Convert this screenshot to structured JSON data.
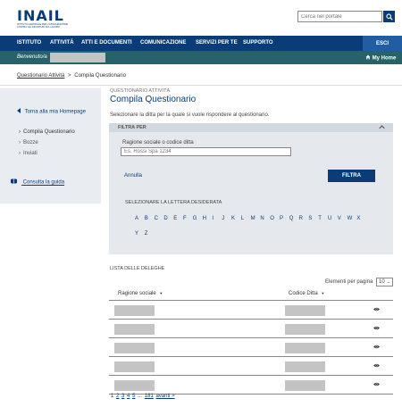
{
  "header": {
    "logo": "INAIL",
    "logo_subtitle": "ISTITUTO NAZIONALE PER L'ASSICURAZIONE CONTRO GLI INFORTUNI SUL LAVORO",
    "search_placeholder": "Cerca nel portale"
  },
  "nav": {
    "items": [
      "ISTITUTO",
      "ATTIVITÀ",
      "ATTI E DOCUMENTI",
      "COMUNICAZIONE",
      "SERVIZI PER TE",
      "SUPPORTO"
    ],
    "logout": "ESCI"
  },
  "welcome": {
    "label": "Benvenuto/a",
    "my_home": "My Home"
  },
  "breadcrumb": {
    "parent": "Questionario Attività",
    "separator": ">",
    "current": "Compila Questionario"
  },
  "sidebar": {
    "back": "Torna alla mia Homepage",
    "items": [
      "Compila Questionario",
      "Bozze",
      "Inviati"
    ],
    "guide": "Consulta la guida"
  },
  "main": {
    "section": "QUESTIONARIO ATTIVITÀ",
    "title": "Compila Questionario",
    "intro": "Selezionare la ditta per la quale si vuole rispondere al questionario."
  },
  "filter": {
    "header": "FILTRA PER",
    "field_label": "Ragione sociale o codice ditta",
    "field_placeholder": "Es. Rossi Spa 1234",
    "cancel": "Annulla",
    "submit": "FILTRA",
    "letters_label": "SELEZIONARE LA LETTERA DESIDERATA",
    "letters": [
      "A",
      "B",
      "C",
      "D",
      "E",
      "F",
      "G",
      "H",
      "I",
      "J",
      "K",
      "L",
      "M",
      "N",
      "O",
      "P",
      "Q",
      "R",
      "S",
      "T",
      "U",
      "V",
      "W",
      "X",
      "Y",
      "Z"
    ]
  },
  "list": {
    "title": "LISTA DELLE DELEGHE",
    "per_page_label": "Elementi per pagina",
    "per_page_value": "10",
    "columns": [
      "Ragione sociale",
      "Codice Ditta"
    ],
    "sort_glyph": "▼",
    "row_count": 5
  },
  "pagination": {
    "current": "1",
    "pages": [
      "2",
      "3",
      "4",
      "5"
    ],
    "ellipsis": "...",
    "last": "181",
    "next": "avanti >"
  },
  "colors": {
    "primary": "#0a3d78",
    "nav_accent": "#205da2",
    "welcome_bar": "#27626b",
    "sidebar_bg": "#e9edf2",
    "panel_bg": "#e5e8ec"
  }
}
